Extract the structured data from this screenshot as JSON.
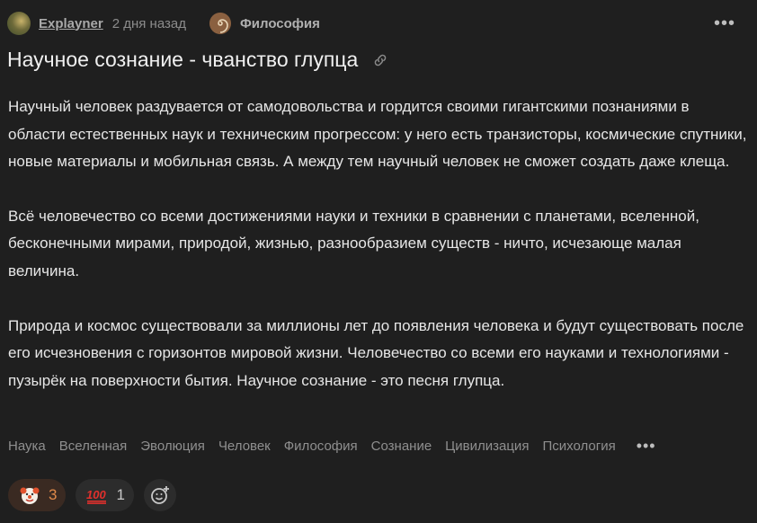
{
  "post": {
    "author": "Explayner",
    "time": "2 дня назад",
    "community": "Философия",
    "title": "Научное сознание - чванство глупца",
    "paragraphs": [
      "Научный человек раздувается от самодовольства и гордится своими гигантскими познаниями в области естественных наук и техническим прогрессом: у него есть транзисторы, космические спутники, новые материалы и мобильная связь. А между тем научный человек не сможет создать даже клеща.",
      "Всё человечество со всеми достижениями науки и техники в сравнении с планетами, вселенной, бесконечными мирами, природой, жизнью, разнообразием существ - ничто, исчезающе малая величина.",
      "Природа и космос существовали за миллионы лет до появления человека и будут существовать после его исчезновения с горизонтов мировой жизни. Человечество со всеми его науками и технологиями - пузырёк на поверхности бытия. Научное сознание - это песня глупца."
    ],
    "tags": [
      "Наука",
      "Вселенная",
      "Эволюция",
      "Человек",
      "Философия",
      "Сознание",
      "Цивилизация",
      "Психология"
    ],
    "more_label": "•••"
  },
  "reactions": [
    {
      "icon": "clown-face-icon",
      "count": "3"
    },
    {
      "icon": "hundred-points-icon",
      "count": "1"
    }
  ],
  "colors": {
    "background": "#1f1f1f",
    "text": "#e6e6e6",
    "muted": "#8f8f8f",
    "reaction_accent": "#e08a4a"
  }
}
